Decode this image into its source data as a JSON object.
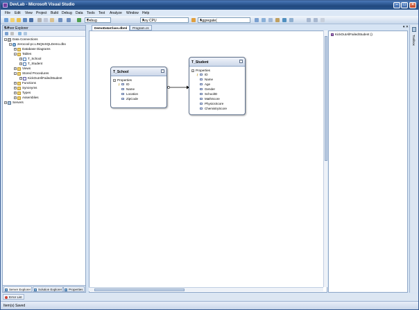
{
  "window": {
    "title": "DevLab - Microsoft Visual Studio"
  },
  "menu": [
    "File",
    "Edit",
    "View",
    "Project",
    "Build",
    "Debug",
    "Data",
    "Tools",
    "Test",
    "Analyze",
    "Window",
    "Help"
  ],
  "toolbar": {
    "configuration": "Debug",
    "platform": "Any CPU",
    "find_value": "Aggregate("
  },
  "server_explorer": {
    "title": "Server Explorer",
    "header_buttons": "▾ ✕",
    "tree": {
      "data_connections": "Data Connections",
      "database": "zerocool-pc.LINQtoSQLDemo.dbo",
      "database_diagrams": "Database Diagrams",
      "tables": "Tables",
      "t_school": "T_School",
      "t_student": "T_Student",
      "views": "Views",
      "stored_procedures": "Stored Procedures",
      "proc_kick": "KickOutAllFailedStudent",
      "functions": "Functions",
      "synonyms": "Synonyms",
      "types": "Types",
      "assemblies": "Assemblies",
      "servers": "Servers"
    },
    "tabs": {
      "server_explorer": "Server Explorer",
      "solution_explorer": "Solution Explorer",
      "properties": "Properties"
    }
  },
  "document_tabs": {
    "dbml": "DemoDataClass.dbml",
    "program": "Program.cs",
    "close": "▾ ✕"
  },
  "entities": {
    "school": {
      "name": "T_School",
      "section": "Properties",
      "properties": [
        "ID",
        "Name",
        "Location",
        "ZipCode"
      ]
    },
    "student": {
      "name": "T_Student",
      "section": "Properties",
      "properties": [
        "ID",
        "Name",
        "Age",
        "Gender",
        "SchoolID",
        "MathScore",
        "PhysicsScore",
        "ChemistryScore"
      ]
    }
  },
  "methods_pane": {
    "item": "KickOutAllFailedStudent ()"
  },
  "toolbox": {
    "label": "Toolbox"
  },
  "bottom": {
    "error_list": "Error List"
  },
  "status": {
    "text": "Item(s) Saved"
  }
}
